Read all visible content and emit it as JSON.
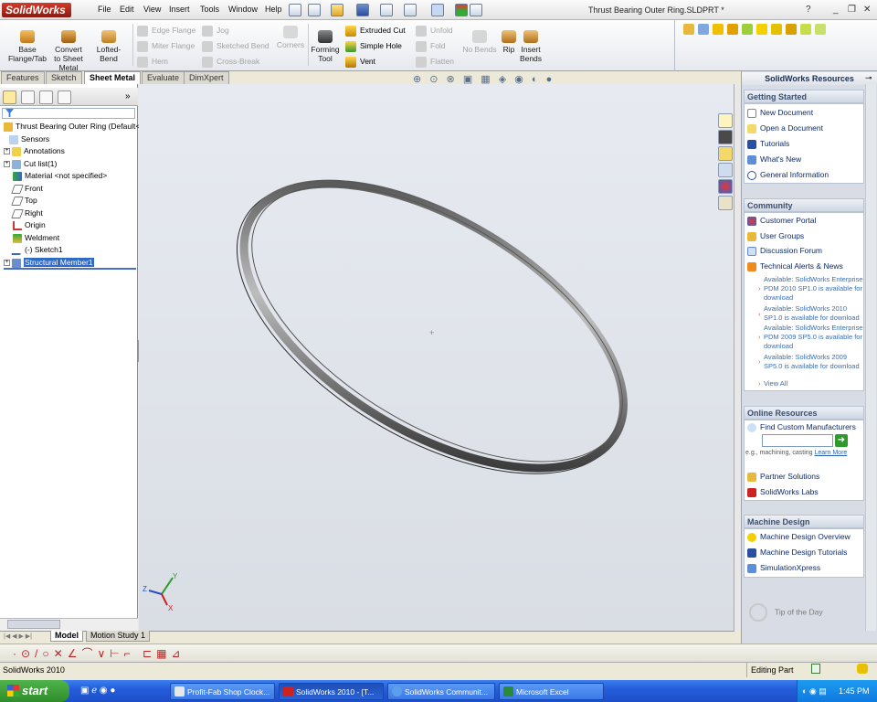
{
  "app": {
    "logo": "SolidWorks",
    "doc_title": "Thrust Bearing Outer Ring.SLDPRT *",
    "help": "?",
    "min": "_",
    "restore": "❐",
    "close": "✕"
  },
  "menus": [
    "File",
    "Edit",
    "View",
    "Insert",
    "Tools",
    "Window",
    "Help"
  ],
  "ribbon": {
    "big": [
      {
        "label": "Base Flange/Tab"
      },
      {
        "label": "Convert to Sheet Metal"
      },
      {
        "label": "Lofted-Bend"
      }
    ],
    "col1": [
      "Edge Flange",
      "Miter Flange",
      "Hem"
    ],
    "col2": [
      "Jog",
      "Sketched Bend",
      "Cross-Break"
    ],
    "corners": "Corners",
    "forming": "Forming Tool",
    "col3": [
      "Extruded Cut",
      "Simple Hole",
      "Vent"
    ],
    "col4": [
      "Unfold",
      "Fold",
      "Flatten"
    ],
    "nobends": "No Bends",
    "rip": "Rip",
    "insertbends": "Insert Bends"
  },
  "tabs": [
    "Features",
    "Sketch",
    "Sheet Metal",
    "Evaluate",
    "DimXpert"
  ],
  "active_tab": "Sheet Metal",
  "tree": {
    "root": "Thrust Bearing Outer Ring  (Default<",
    "items": [
      "Sensors",
      "Annotations",
      "Cut list(1)",
      "Material <not specified>",
      "Front",
      "Top",
      "Right",
      "Origin",
      "Weldment",
      "(-) Sketch1",
      "Structural Member1"
    ]
  },
  "bottom_tabs": [
    "Model",
    "Motion Study 1"
  ],
  "taskpane": {
    "title": "SolidWorks Resources",
    "getting_started": {
      "header": "Getting Started",
      "items": [
        "New Document",
        "Open a Document",
        "Tutorials",
        "What's New",
        "General Information"
      ]
    },
    "community": {
      "header": "Community",
      "items": [
        "Customer Portal",
        "User Groups",
        "Discussion Forum",
        "Technical Alerts & News"
      ],
      "news": [
        "Available: SolidWorks Enterprise PDM 2010 SP1.0 is available for download",
        "Available: SolidWorks 2010 SP1.0 is available for download",
        "Available: SolidWorks Enterprise PDM 2009 SP5.0 is available for download",
        "Available: SolidWorks 2009 SP5.0 is available for download"
      ],
      "view_all": "View All"
    },
    "online": {
      "header": "Online Resources",
      "find": "Find Custom Manufacturers",
      "hint": "e.g., machining, casting",
      "learn": "Learn More",
      "items": [
        "Partner Solutions",
        "SolidWorks Labs"
      ]
    },
    "machine": {
      "header": "Machine Design",
      "items": [
        "Machine Design Overview",
        "Machine Design Tutorials",
        "SimulationXpress"
      ]
    },
    "tip": "Tip of the Day"
  },
  "status": {
    "left": "SolidWorks 2010",
    "mode": "Editing Part"
  },
  "taskbar": {
    "start": "start",
    "buttons": [
      "Profit-Fab Shop Clock...",
      "SolidWorks 2010 - [T...",
      "SolidWorks Communit...",
      "Microsoft Excel"
    ],
    "time": "1:45 PM"
  },
  "triad": {
    "x": "X",
    "y": "Y",
    "z": "Z"
  }
}
